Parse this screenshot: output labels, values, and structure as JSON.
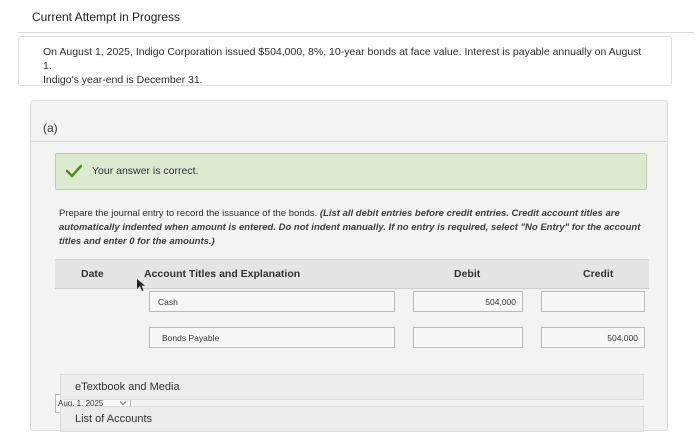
{
  "header": {
    "title": "Current Attempt in Progress"
  },
  "prompt": {
    "line1": "On August 1, 2025, Indigo Corporation issued $504,000, 8%, 10-year bonds at face value. Interest is payable annually on August 1.",
    "line2": "Indigo's year-end is December 31."
  },
  "part": {
    "label": "(a)",
    "status_text": "Your answer is correct.",
    "instruction_plain": "Prepare the journal entry to record the issuance of the bonds.",
    "instruction_emphasis": "(List all debit entries before credit entries. Credit account titles are automatically indented when amount is entered. Do not indent manually. If no entry is required, select \"No Entry\" for the account titles and enter 0 for the amounts.)"
  },
  "journal": {
    "columns": {
      "date": "Date",
      "account": "Account Titles and Explanation",
      "debit": "Debit",
      "credit": "Credit"
    },
    "rows": [
      {
        "date": "Aug. 1, 2025",
        "account": "Cash",
        "debit": "504,000",
        "credit": ""
      },
      {
        "date": "",
        "account": "Bonds Payable",
        "debit": "",
        "credit": "504,000"
      }
    ]
  },
  "resources": {
    "etextbook": "eTextbook and Media",
    "accounts": "List of Accounts"
  },
  "icons": {
    "status": "check-icon",
    "date_dropdown": "chevron-down-icon",
    "pointer": "cursor-icon"
  },
  "colors": {
    "success_bg": "#dcead0",
    "success_check": "#4f8f24"
  }
}
